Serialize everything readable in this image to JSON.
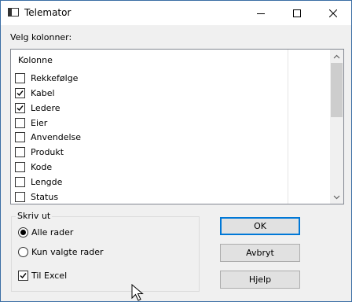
{
  "window": {
    "title": "Telemator"
  },
  "columns": {
    "prompt": "Velg kolonner:",
    "header": "Kolonne",
    "items": [
      {
        "label": "Rekkefølge",
        "checked": false
      },
      {
        "label": "Kabel",
        "checked": true
      },
      {
        "label": "Ledere",
        "checked": true
      },
      {
        "label": "Eier",
        "checked": false
      },
      {
        "label": "Anvendelse",
        "checked": false
      },
      {
        "label": "Produkt",
        "checked": false
      },
      {
        "label": "Kode",
        "checked": false
      },
      {
        "label": "Lengde",
        "checked": false
      },
      {
        "label": "Status",
        "checked": false
      }
    ]
  },
  "print": {
    "group_label": "Skriv ut",
    "all_rows": "Alle rader",
    "selected_rows": "Kun valgte rader",
    "selected_option": "all_rows",
    "to_excel": "Til Excel",
    "to_excel_checked": true
  },
  "buttons": {
    "ok": "OK",
    "cancel": "Avbryt",
    "help": "Hjelp"
  }
}
